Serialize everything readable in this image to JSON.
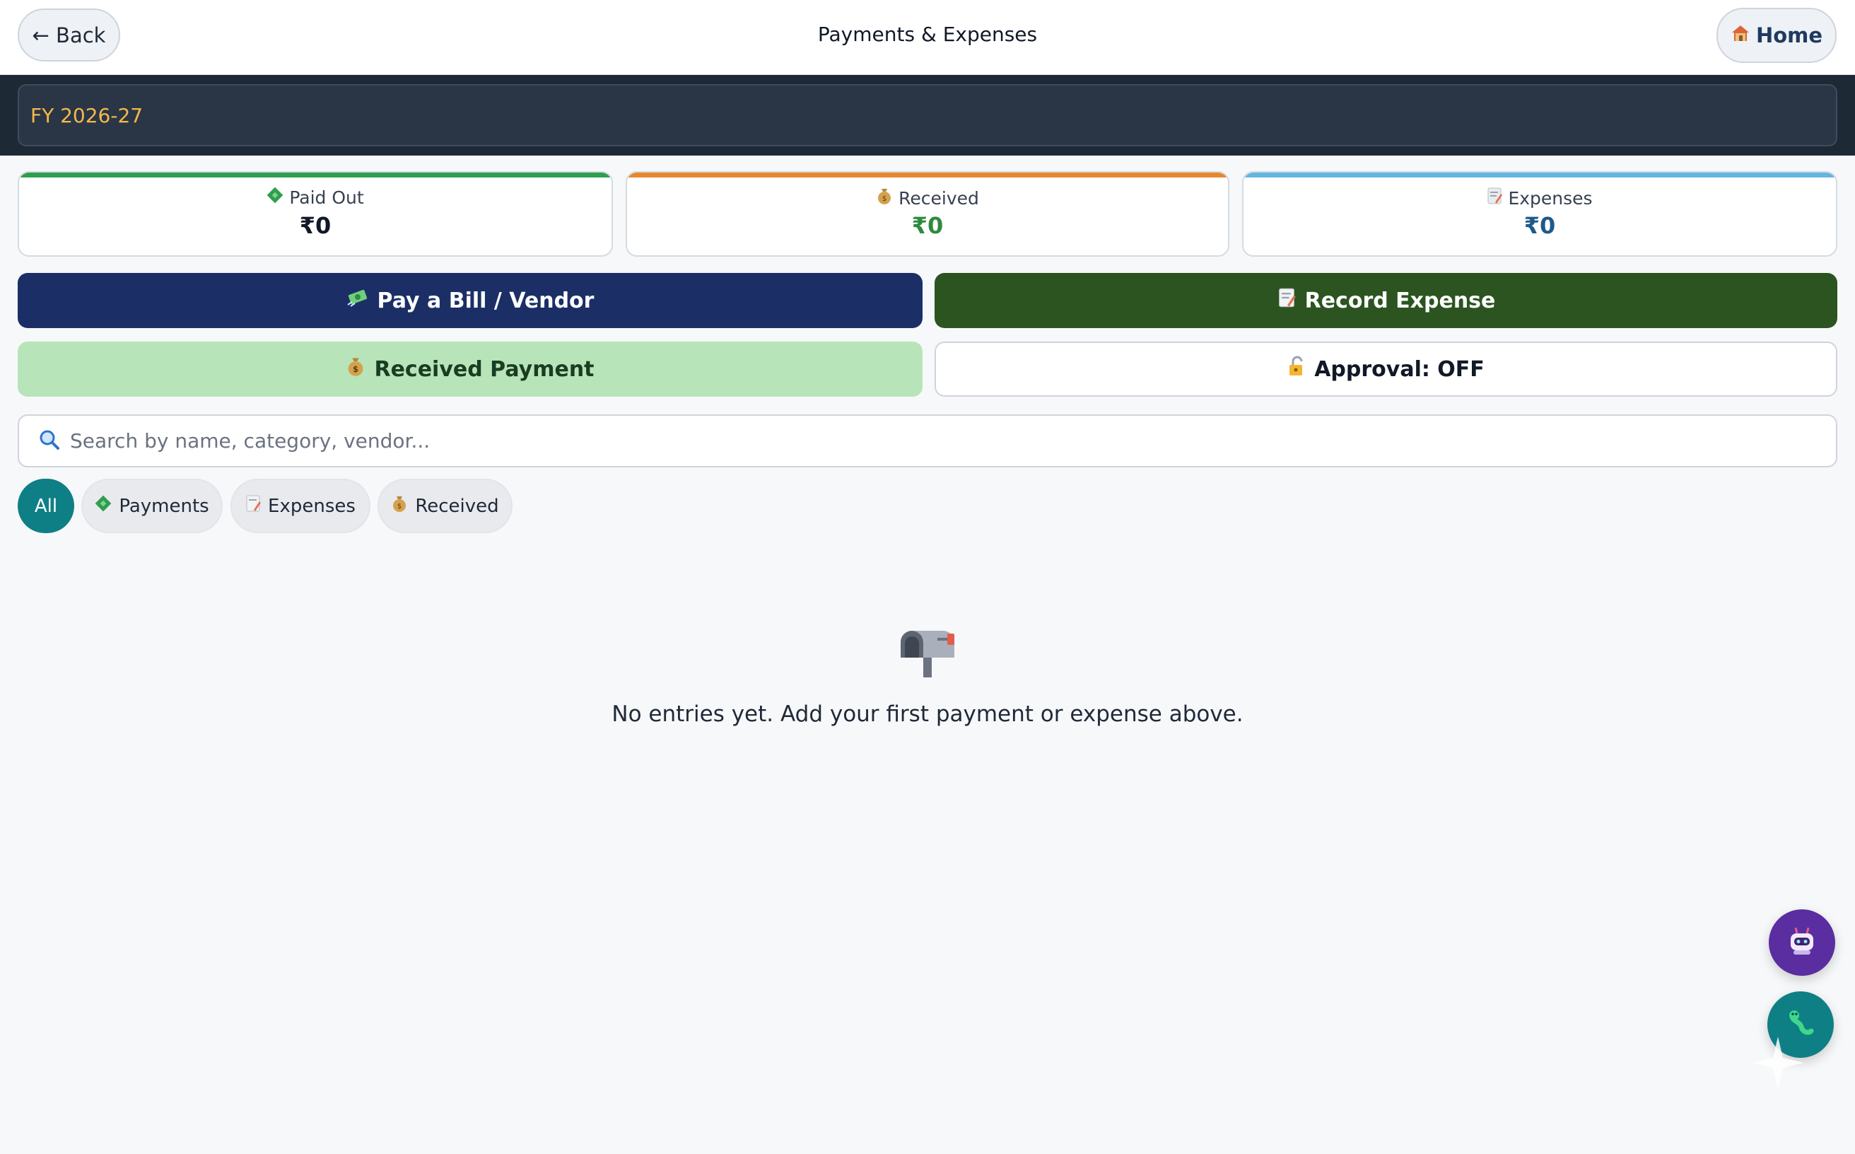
{
  "header": {
    "back_label": "← Back",
    "title": "Payments & Expenses",
    "home_label": "Home",
    "home_icon": "house-icon"
  },
  "fiscal_year": {
    "selected": "FY 2026-27"
  },
  "summary": {
    "paid_out": {
      "label": "Paid Out",
      "value": "₹0",
      "icon": "money-card-icon",
      "accent": "#2f9e4f",
      "value_color": "#111827"
    },
    "received": {
      "label": "Received",
      "value": "₹0",
      "icon": "money-bag-icon",
      "accent": "#e8862f",
      "value_color": "#2f8a3e"
    },
    "expenses": {
      "label": "Expenses",
      "value": "₹0",
      "icon": "memo-icon",
      "accent": "#62b7e0",
      "value_color": "#1e5a8a"
    }
  },
  "actions": {
    "pay_bill": {
      "label": "Pay a Bill / Vendor",
      "icon": "flying-money-icon",
      "bg": "#1b2f66"
    },
    "record_expense": {
      "label": "Record Expense",
      "icon": "memo-icon",
      "bg": "#2b5420"
    },
    "received_payment": {
      "label": "Received Payment",
      "icon": "money-bag-icon",
      "bg": "#b7e4b8"
    },
    "approval": {
      "label": "Approval: OFF",
      "icon": "unlocked-icon"
    }
  },
  "search": {
    "placeholder": "Search by name, category, vendor...",
    "value": ""
  },
  "filters": {
    "all": "All",
    "payments": "Payments",
    "expenses": "Expenses",
    "received": "Received",
    "active": "All"
  },
  "empty_state": {
    "icon": "mailbox-icon",
    "message": "No entries yet. Add your first payment or expense above."
  },
  "floating": {
    "assistant_icon": "robot-icon",
    "whatsapp_icon": "chat-icon",
    "assistant_color": "#5a2da0",
    "chat_color": "#0f7f86"
  }
}
